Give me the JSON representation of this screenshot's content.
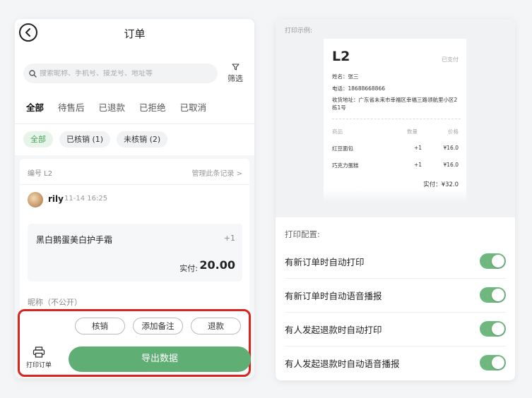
{
  "left": {
    "title": "订单",
    "search_placeholder": "搜索昵称、手机号、接龙号、地址等",
    "filter_label": "筛选",
    "tabs": [
      {
        "label": "全部",
        "active": true
      },
      {
        "label": "待售后",
        "active": false
      },
      {
        "label": "已退款",
        "active": false
      },
      {
        "label": "已拒绝",
        "active": false
      },
      {
        "label": "已取消",
        "active": false
      }
    ],
    "chips": [
      {
        "label": "全部",
        "active": true
      },
      {
        "label": "已核销 (1)",
        "active": false
      },
      {
        "label": "未核销 (2)",
        "active": false
      }
    ],
    "order": {
      "number": "编号 L2",
      "manage": "管理此条记录 >",
      "user": "rily",
      "time": "11-14 16:25",
      "item_name": "黑白鹅蛋美白护手霜",
      "item_qty": "+1",
      "paid_label": "实付:",
      "paid_amount": "20.00",
      "nickname": "昵称（不公开）"
    },
    "actions": {
      "verify": "核销",
      "add_note": "添加备注",
      "refund": "退款",
      "print_order": "打印订单",
      "export": "导出数据"
    }
  },
  "right": {
    "preview_label": "打印示例:",
    "receipt": {
      "code": "L2",
      "status": "已支付",
      "name": "姓名：张三",
      "phone": "电话：18688668866",
      "address": "收货地址：广东省未来市幸福区幸福三路领航里小区2栋1号",
      "col_item": "商品",
      "col_qty": "数量",
      "col_price": "价格",
      "items": [
        {
          "name": "红豆面包",
          "qty": "+1",
          "price": "¥16.0"
        },
        {
          "name": "巧克力蛋糕",
          "qty": "+1",
          "price": "¥16.0"
        }
      ],
      "total": "实付：¥32.0"
    },
    "config_label": "打印配置:",
    "settings": [
      {
        "label": "有新订单时自动打印",
        "enabled": true
      },
      {
        "label": "有新订单时自动语音播报",
        "enabled": true
      },
      {
        "label": "有人发起退款时自动打印",
        "enabled": true
      },
      {
        "label": "有人发起退款时自动语音播报",
        "enabled": true
      }
    ]
  },
  "colors": {
    "accent_green": "#5fae74",
    "highlight_red": "#d9251d"
  }
}
